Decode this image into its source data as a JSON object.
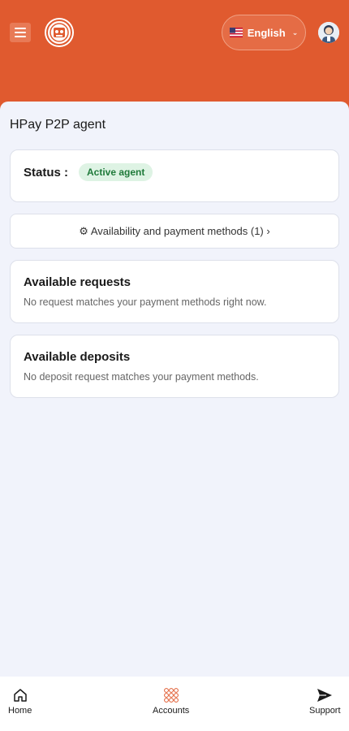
{
  "header": {
    "language_label": "English",
    "menu_icon": "hamburger-icon",
    "colors": {
      "header_bg": "#e05a2f",
      "accent": "#e05a2f"
    }
  },
  "page": {
    "title": "HPay P2P agent"
  },
  "status": {
    "label": "Status :",
    "badge": "Active agent"
  },
  "availability_button": {
    "label": "⚙ Availability and payment methods (1) ›"
  },
  "requests": {
    "title": "Available requests",
    "empty_text": "No request matches your payment methods right now."
  },
  "deposits": {
    "title": "Available deposits",
    "empty_text": "No deposit request matches your payment methods."
  },
  "bottom_nav": {
    "items": [
      {
        "label": "Home",
        "icon": "home-icon"
      },
      {
        "label": "Accounts",
        "icon": "grid-icon"
      },
      {
        "label": "Support",
        "icon": "send-icon"
      }
    ]
  }
}
